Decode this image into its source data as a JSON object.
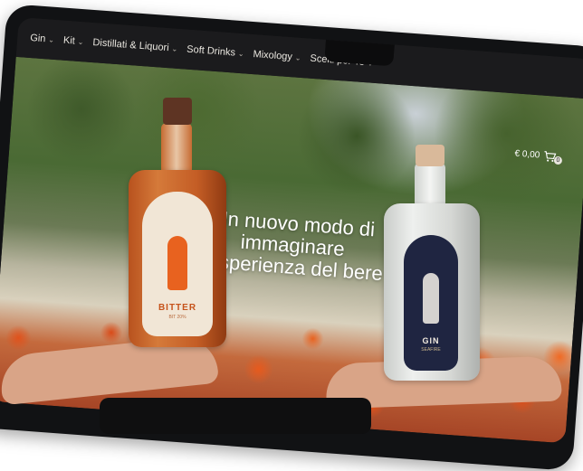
{
  "nav": {
    "items": [
      {
        "label": "Gin"
      },
      {
        "label": "Kit"
      },
      {
        "label": "Distillati & Liquori"
      },
      {
        "label": "Soft Drinks"
      },
      {
        "label": "Mixology"
      },
      {
        "label": "Scelti per Te"
      }
    ]
  },
  "cart": {
    "total": "€ 0,00",
    "count": "0"
  },
  "hero": {
    "headline_line1": "Un nuovo modo di",
    "headline_line2": "immaginare",
    "headline_line3": "l’esperienza del bere"
  },
  "bottles": {
    "bitter": {
      "name": "BITTER",
      "sub": "BIT 20%"
    },
    "gin": {
      "name": "GIN",
      "sub": "SEAFIRE"
    }
  },
  "icons": [
    "chevron-down-icon",
    "cart-icon"
  ],
  "colors": {
    "navbar": "#1b1b1d",
    "nav_text": "#e9e6df",
    "headline": "#ffffff",
    "poppy": "#e8621f"
  }
}
